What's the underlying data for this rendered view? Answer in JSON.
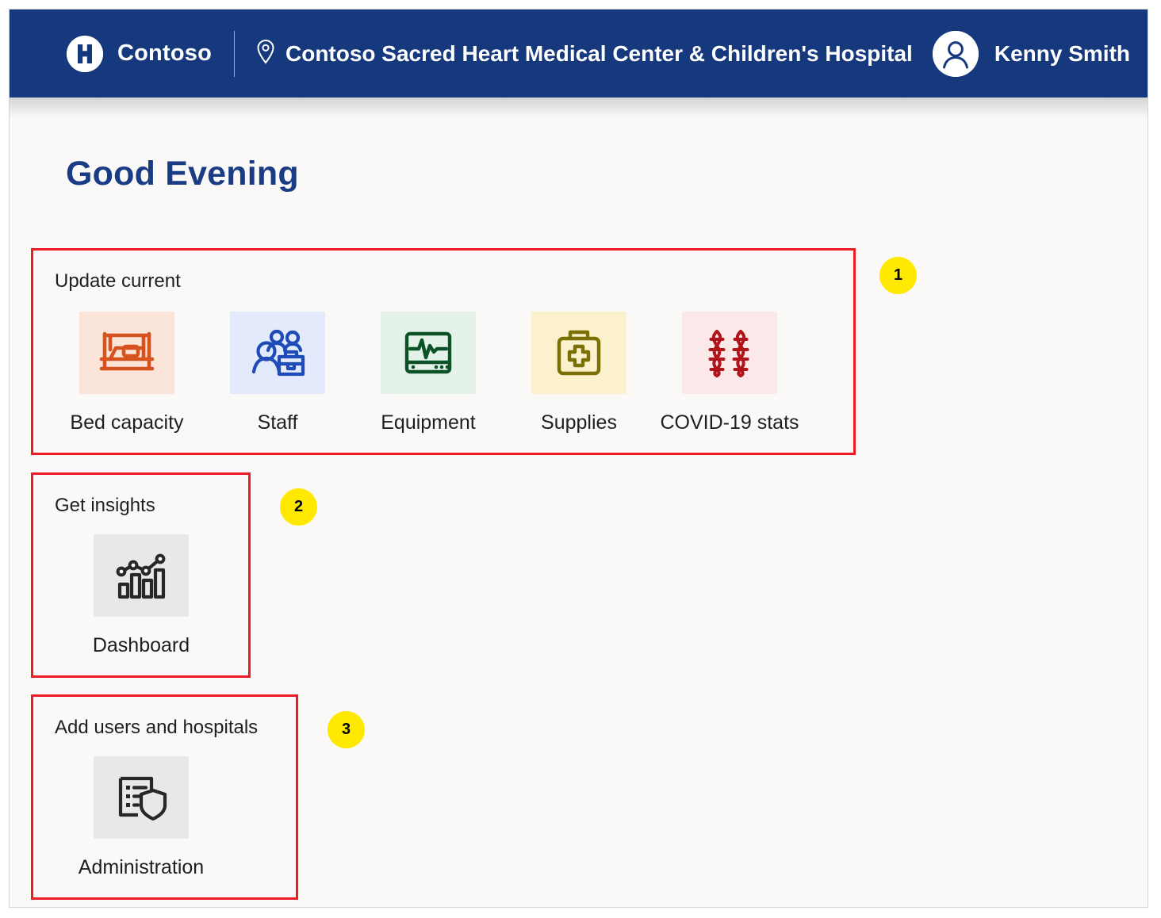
{
  "header": {
    "brand_name": "Contoso",
    "brand_logo_letter": "H",
    "facility_name": "Contoso Sacred Heart Medical Center & Children's Hospital",
    "user_name": "Kenny Smith",
    "background_color": "#16397e"
  },
  "main": {
    "greeting": "Good Evening",
    "greeting_color": "#1a3c84",
    "background_color": "#faf9f8"
  },
  "sections": [
    {
      "title": "Update current",
      "badge": "1",
      "tiles": [
        {
          "label": "Bed capacity",
          "icon": "bed-icon",
          "icon_color": "#d6531f",
          "tile_bg": "#fbe5d9"
        },
        {
          "label": "Staff",
          "icon": "staff-icon",
          "icon_color": "#1f4bb8",
          "tile_bg": "#e2eafb"
        },
        {
          "label": "Equipment",
          "icon": "monitor-icon",
          "icon_color": "#0b5226",
          "tile_bg": "#e5f2ea"
        },
        {
          "label": "Supplies",
          "icon": "medkit-icon",
          "icon_color": "#7b7003",
          "tile_bg": "#fbf1cd"
        },
        {
          "label": "COVID-19 stats",
          "icon": "dna-icon",
          "icon_color": "#b01419",
          "tile_bg": "#fbe8e8"
        }
      ]
    },
    {
      "title": "Get insights",
      "badge": "2",
      "tiles": [
        {
          "label": "Dashboard",
          "icon": "bar-chart-icon",
          "icon_color": "#272727",
          "tile_bg": "#e9e8e7"
        }
      ]
    },
    {
      "title": "Add users and hospitals",
      "badge": "3",
      "tiles": [
        {
          "label": "Administration",
          "icon": "list-shield-icon",
          "icon_color": "#272727",
          "tile_bg": "#e9e8e7"
        }
      ]
    }
  ],
  "annotation": {
    "outline_color": "#ed1c24",
    "badge_color": "#ffe900"
  }
}
